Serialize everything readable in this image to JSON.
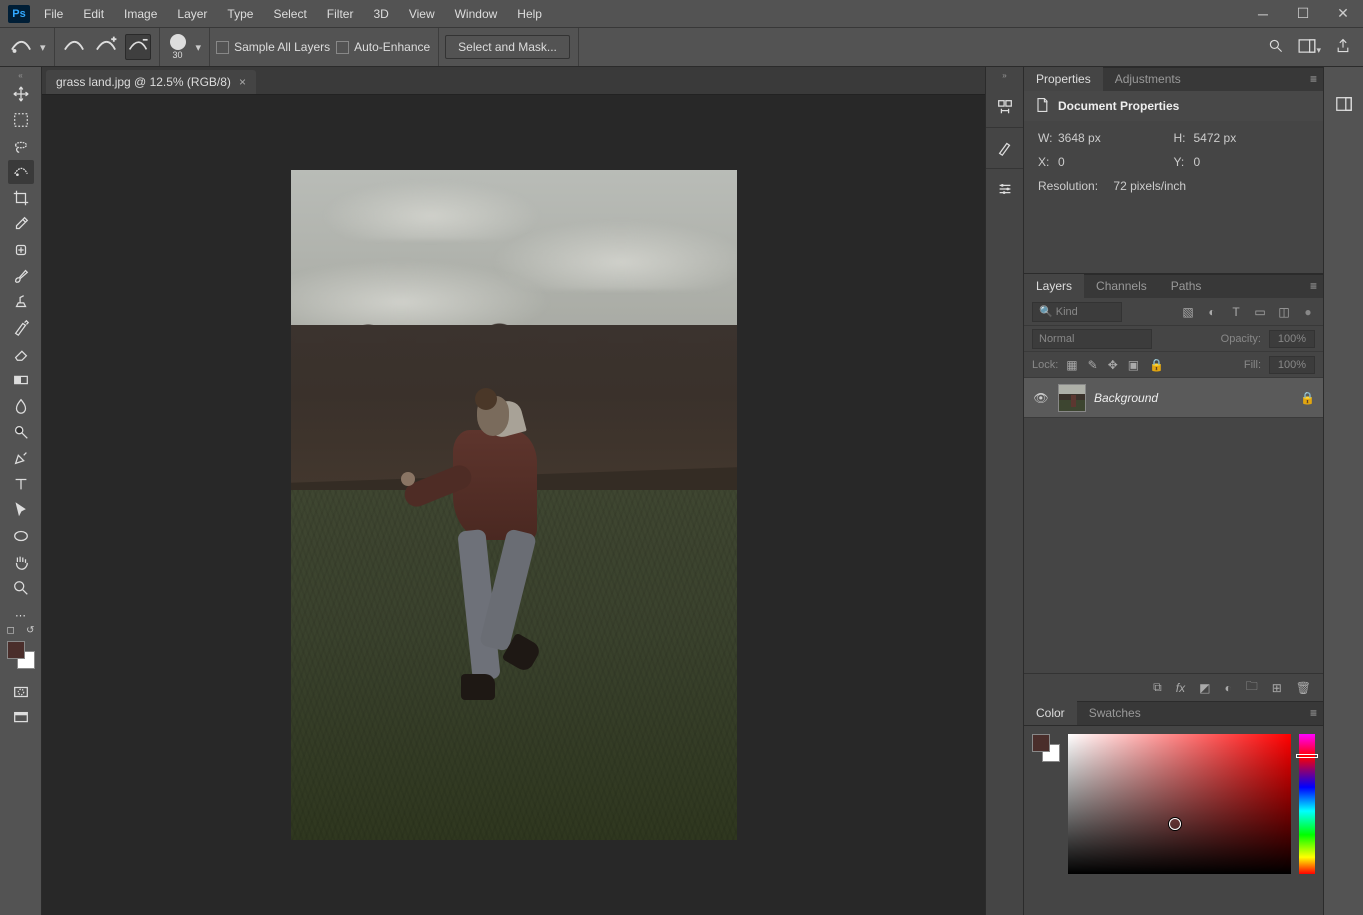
{
  "menu": [
    "File",
    "Edit",
    "Image",
    "Layer",
    "Type",
    "Select",
    "Filter",
    "3D",
    "View",
    "Window",
    "Help"
  ],
  "options": {
    "brush_size": "30",
    "chk_sample_all": "Sample All Layers",
    "chk_autoenhance": "Auto-Enhance",
    "select_mask_btn": "Select and Mask..."
  },
  "doc": {
    "tab_title": "grass land.jpg @ 12.5% (RGB/8)"
  },
  "properties": {
    "tab_props": "Properties",
    "tab_adjust": "Adjustments",
    "header": "Document Properties",
    "w_label": "W:",
    "w": "3648 px",
    "h_label": "H:",
    "h": "5472 px",
    "x_label": "X:",
    "x": "0",
    "y_label": "Y:",
    "y": "0",
    "res_label": "Resolution:",
    "res": "72 pixels/inch"
  },
  "layers": {
    "tab_layers": "Layers",
    "tab_channels": "Channels",
    "tab_paths": "Paths",
    "kind_label": "Kind",
    "blend": "Normal",
    "opacity_label": "Opacity:",
    "opacity": "100%",
    "lock_label": "Lock:",
    "fill_label": "Fill:",
    "fill": "100%",
    "rows": [
      {
        "name": "Background"
      }
    ]
  },
  "colors": {
    "tab_color": "Color",
    "tab_swatches": "Swatches",
    "fg": "#4a2e2b",
    "bg": "#ffffff"
  }
}
